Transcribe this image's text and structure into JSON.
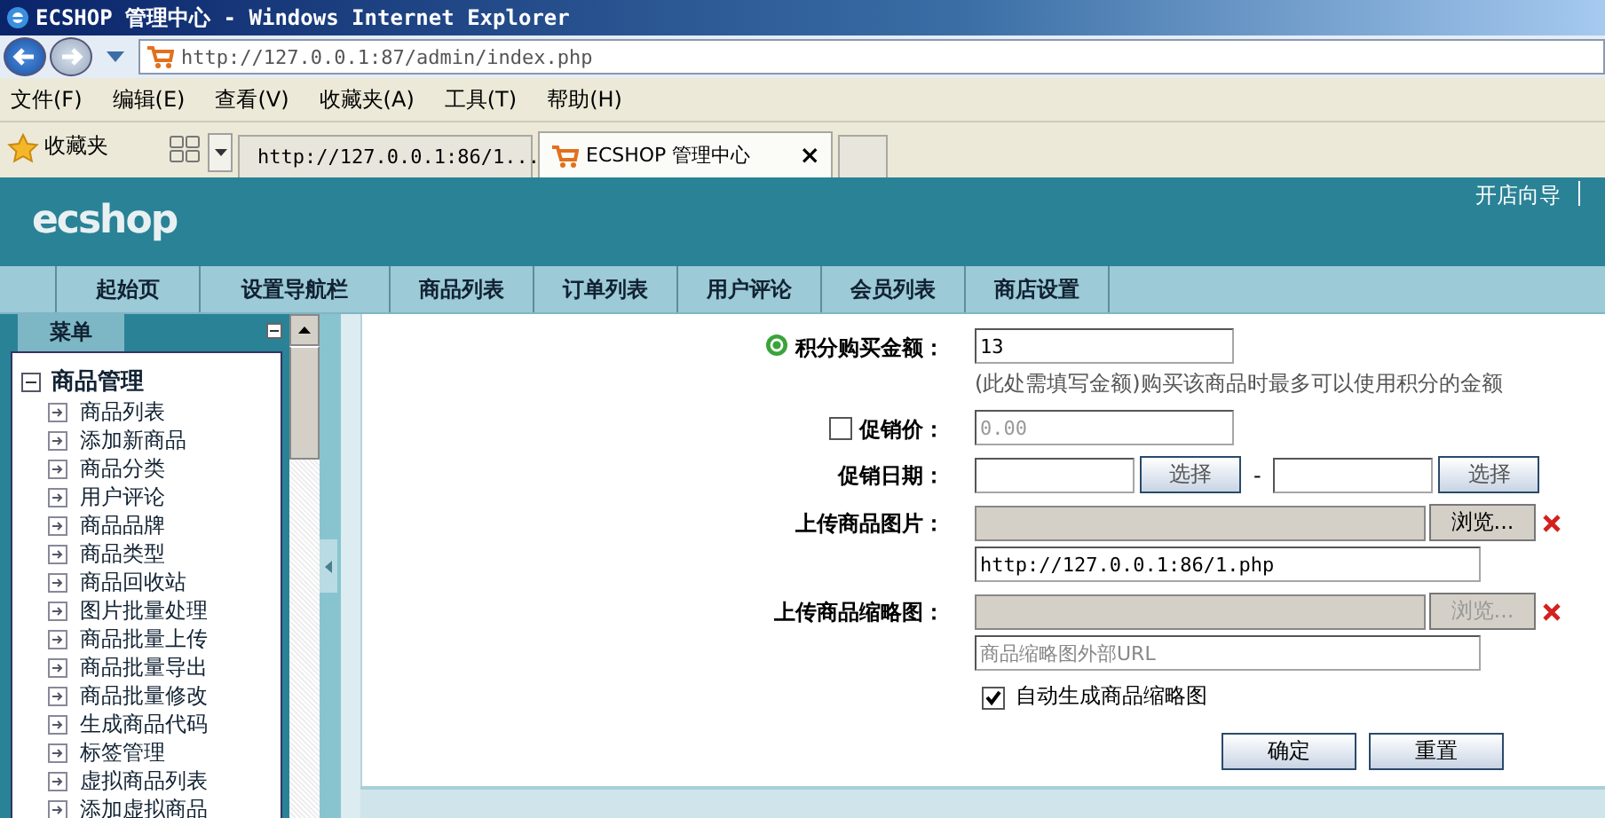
{
  "window": {
    "title": "ECSHOP 管理中心 - Windows Internet Explorer"
  },
  "address_bar": {
    "url": "http://127.0.0.1:87/admin/index.php"
  },
  "menu_bar": [
    "文件(F)",
    "编辑(E)",
    "查看(V)",
    "收藏夹(A)",
    "工具(T)",
    "帮助(H)"
  ],
  "favorites": {
    "label": "收藏夹"
  },
  "tabs": [
    {
      "label": "http://127.0.0.1:86/1...",
      "selected": false
    },
    {
      "label": "ECSHOP 管理中心",
      "selected": true,
      "close": "×"
    }
  ],
  "header": {
    "logo": "ecshop",
    "link": "开店向导"
  },
  "nav": [
    {
      "label": "起始页"
    },
    {
      "label": "设置导航栏"
    },
    {
      "label": "商品列表"
    },
    {
      "label": "订单列表"
    },
    {
      "label": "用户评论"
    },
    {
      "label": "会员列表"
    },
    {
      "label": "商店设置"
    }
  ],
  "sidebar": {
    "title": "菜单",
    "tree": [
      {
        "label": "商品管理",
        "expanded": true,
        "children": [
          {
            "label": "商品列表"
          },
          {
            "label": "添加新商品"
          },
          {
            "label": "商品分类"
          },
          {
            "label": "用户评论"
          },
          {
            "label": "商品品牌"
          },
          {
            "label": "商品类型"
          },
          {
            "label": "商品回收站"
          },
          {
            "label": "图片批量处理"
          },
          {
            "label": "商品批量上传"
          },
          {
            "label": "商品批量导出"
          },
          {
            "label": "商品批量修改"
          },
          {
            "label": "生成商品代码"
          },
          {
            "label": "标签管理"
          },
          {
            "label": "虚拟商品列表"
          },
          {
            "label": "添加虚拟商品"
          }
        ]
      }
    ]
  },
  "form": {
    "rows": [
      {
        "kind": "text",
        "label": "积分购买金额：",
        "help": true,
        "value": "13",
        "hint": "(此处需填写金额)购买该商品时最多可以使用积分的金额"
      },
      {
        "kind": "checkprice",
        "label": "促销价：",
        "checked": false,
        "value": "0.00",
        "disabled": true
      },
      {
        "kind": "daterange",
        "label": "促销日期：",
        "buttons": [
          "选择",
          "选择"
        ],
        "separator": "-"
      },
      {
        "kind": "file",
        "label": "上传商品图片：",
        "button": "浏览...",
        "disabled": false,
        "url": {
          "value": "http://127.0.0.1:86/1.php"
        }
      },
      {
        "kind": "file",
        "label": "上传商品缩略图：",
        "button": "浏览...",
        "disabled": true,
        "url": {
          "placeholder": "商品缩略图外部URL"
        }
      },
      {
        "kind": "checkbox",
        "label": "自动生成商品缩略图",
        "checked": true
      }
    ],
    "buttons": [
      "确定",
      "重置"
    ]
  }
}
